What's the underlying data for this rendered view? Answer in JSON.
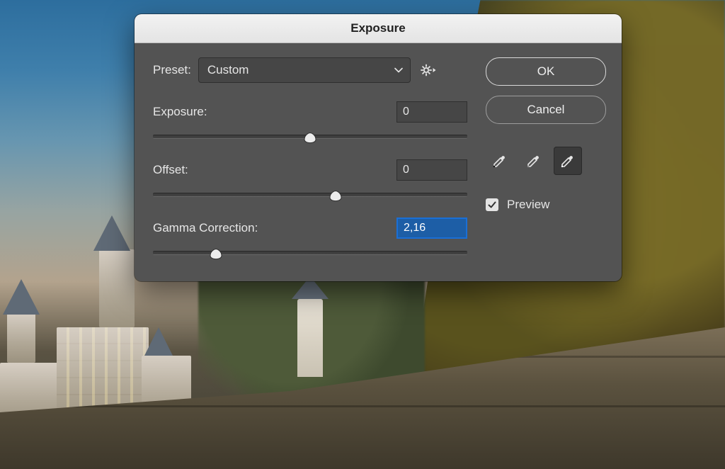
{
  "dialog": {
    "title": "Exposure",
    "preset": {
      "label": "Preset:",
      "value": "Custom"
    },
    "params": {
      "exposure": {
        "label": "Exposure:",
        "value": "0",
        "thumb_pct": 50
      },
      "offset": {
        "label": "Offset:",
        "value": "0",
        "thumb_pct": 58
      },
      "gamma": {
        "label": "Gamma Correction:",
        "value": "2,16",
        "thumb_pct": 20
      }
    },
    "buttons": {
      "ok": "OK",
      "cancel": "Cancel"
    },
    "preview": {
      "label": "Preview",
      "checked": true
    },
    "eyedroppers": {
      "black": "eyedropper-black",
      "gray": "eyedropper-gray",
      "white": "eyedropper-white",
      "active": "white"
    }
  }
}
